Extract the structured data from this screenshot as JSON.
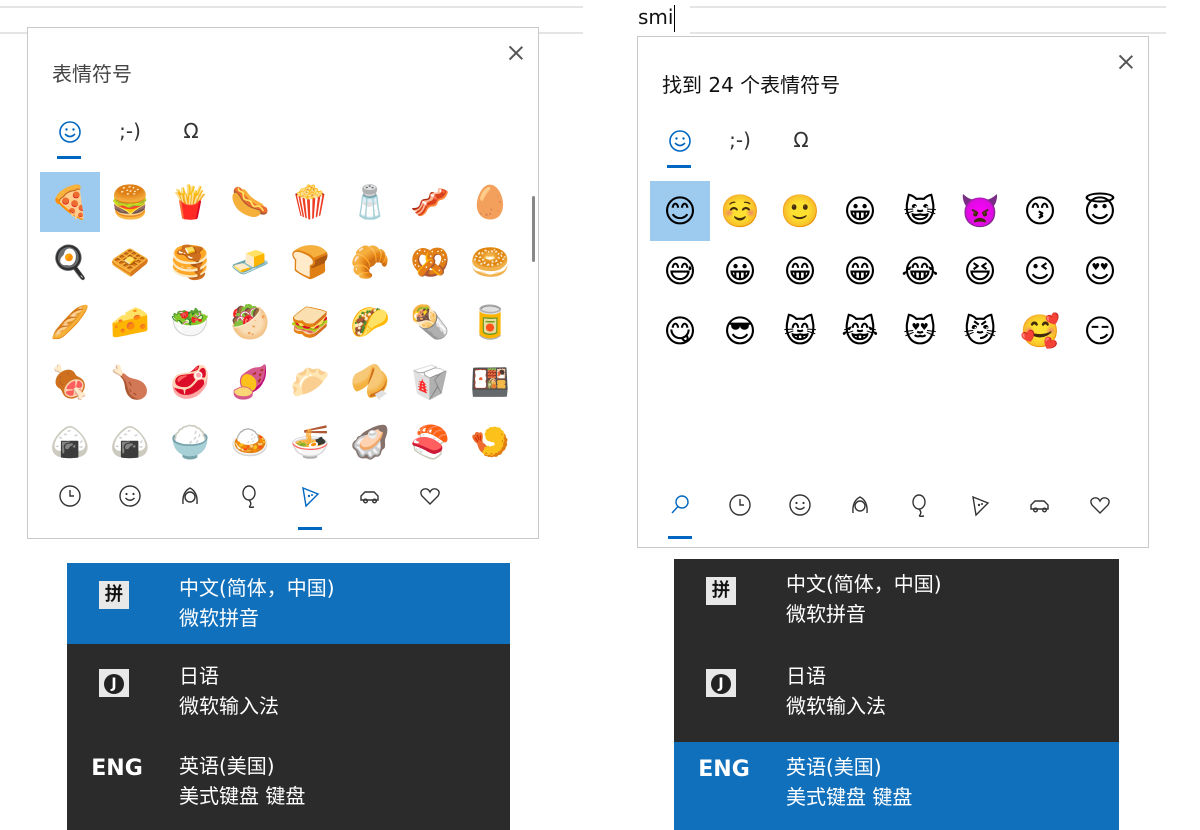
{
  "left_panel": {
    "title": "表情符号",
    "tabs": [
      {
        "name": "emoji",
        "label": "☺"
      },
      {
        "name": "kaomoji",
        "label": ";-)"
      },
      {
        "name": "symbols",
        "label": "Ω"
      }
    ],
    "active_tab": "emoji",
    "grid": [
      [
        "🍕",
        "🍔",
        "🍟",
        "🌭",
        "🍿",
        "🧂",
        "🥓",
        "🥚"
      ],
      [
        "🍳",
        "🧇",
        "🥞",
        "🧈",
        "🍞",
        "🥐",
        "🥨",
        "🥯"
      ],
      [
        "🥖",
        "🧀",
        "🥗",
        "🥙",
        "🥪",
        "🌮",
        "🌯",
        "🥫"
      ],
      [
        "🍖",
        "🍗",
        "🥩",
        "🍠",
        "🥟",
        "🥠",
        "🥡",
        "🍱"
      ],
      [
        "🍙",
        "🍙",
        "🍚",
        "🍛",
        "🍜",
        "🦪",
        "🍣",
        "🍤"
      ]
    ],
    "selected_cell": "🍕",
    "categories": [
      "🕒",
      "☺",
      "👩",
      "🎈",
      "🍕",
      "🚗",
      "♡"
    ],
    "active_category": 4
  },
  "right_panel": {
    "search_text": "smi",
    "title": "找到 24 个表情符号",
    "tabs": [
      {
        "name": "emoji",
        "label": "☺"
      },
      {
        "name": "kaomoji",
        "label": ";-)"
      },
      {
        "name": "symbols",
        "label": "Ω"
      }
    ],
    "active_tab": "emoji",
    "grid": [
      [
        "😊",
        "☺️",
        "🙂",
        "😀",
        "😺",
        "👿",
        "😙",
        "😇"
      ],
      [
        "😅",
        "😀",
        "😁",
        "😁",
        "😂",
        "😆",
        "😉",
        "😍"
      ],
      [
        "😋",
        "😎",
        "😸",
        "😹",
        "😻",
        "😼",
        "🥰",
        "😏"
      ]
    ],
    "selected_cell": "😊",
    "categories": [
      "🔍",
      "🕒",
      "☺",
      "👩",
      "🎈",
      "🍕",
      "🚗",
      "♡"
    ],
    "active_category": 0
  },
  "ime_left": {
    "items": [
      {
        "icon": "拼",
        "name": "中文(简体，中国)",
        "sub": "微软拼音",
        "active": true
      },
      {
        "icon": "J",
        "name": "日语",
        "sub": "微软输入法",
        "active": false
      },
      {
        "icon": "ENG",
        "name": "英语(美国)",
        "sub": "美式键盘 键盘",
        "active": false
      }
    ]
  },
  "ime_right": {
    "items": [
      {
        "icon": "拼",
        "name": "中文(简体，中国)",
        "sub": "微软拼音",
        "active": false
      },
      {
        "icon": "J",
        "name": "日语",
        "sub": "微软输入法",
        "active": false
      },
      {
        "icon": "ENG",
        "name": "英语(美国)",
        "sub": "美式键盘 键盘",
        "active": true
      }
    ]
  },
  "colors": {
    "accent": "#0067c0",
    "selection": "#9ccbef",
    "ime_bg": "#2b2b2b",
    "ime_active": "#1170bb"
  }
}
